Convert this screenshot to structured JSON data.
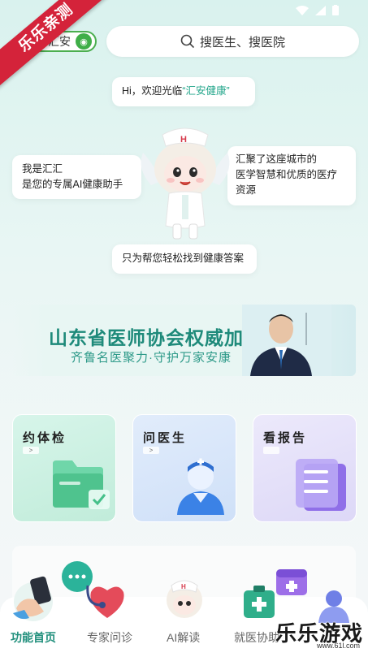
{
  "watermark_ribbon": "乐乐亲测",
  "brand": {
    "label": "康汇安"
  },
  "search": {
    "placeholder": "搜医生、搜医院"
  },
  "bubbles": {
    "greeting_prefix": "Hi，欢迎光临",
    "greeting_name": "“汇安健康”",
    "intro_line1": "我是汇汇",
    "intro_line2": "是您的专属AI健康助手",
    "gather_line1": "汇聚了这座城市的",
    "gather_line2": "医学智慧和优质的医疗",
    "gather_line3": "资源",
    "help": "只为帮您轻松找到健康答案"
  },
  "banner": {
    "title": "山东省医师协会权威加持",
    "subtitle": "齐鲁名医聚力·守护万家安康"
  },
  "cards": [
    {
      "title": "约体检",
      "arrow": ">"
    },
    {
      "title": "问医生",
      "arrow": ">"
    },
    {
      "title": "看报告",
      "arrow": ""
    }
  ],
  "tabs": [
    {
      "label": "功能首页"
    },
    {
      "label": "专家问诊"
    },
    {
      "label": "AI解读"
    },
    {
      "label": "就医协助"
    }
  ],
  "watermark": {
    "text": "乐乐游戏",
    "url": "www.61l.com"
  },
  "colors": {
    "accent": "#22907d",
    "ribbon": "#d4233a"
  }
}
